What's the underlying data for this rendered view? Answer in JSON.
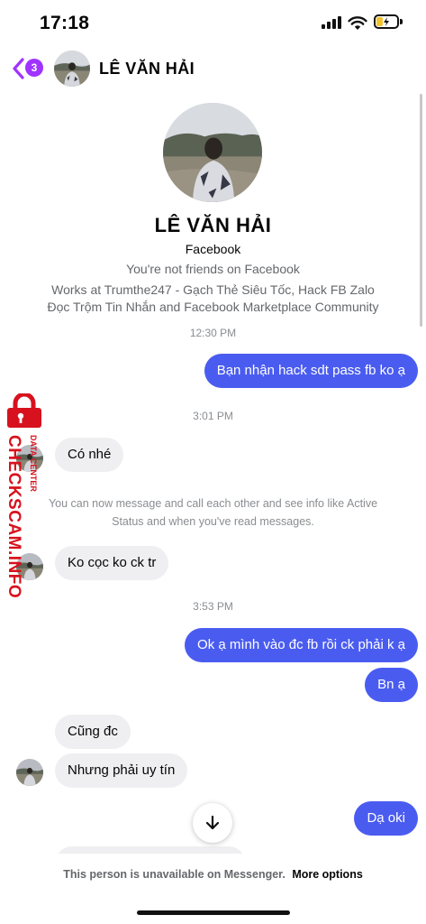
{
  "status_bar": {
    "time": "17:18"
  },
  "header": {
    "unread_count": "3",
    "contact_name": "LÊ VĂN HẢI"
  },
  "profile": {
    "name": "LÊ VĂN HẢI",
    "source": "Facebook",
    "friend_status": "You're not friends on Facebook",
    "works_line1": "Works at Trumthe247 - Gạch Thẻ Siêu Tốc, Hack FB Zalo",
    "works_line2": "Đọc Trộm Tin Nhắn and Facebook Marketplace Community"
  },
  "conversation": {
    "time_1": "12:30 PM",
    "msg_out_1": "Bạn nhận hack sdt pass fb ko ạ",
    "time_2": "3:01 PM",
    "msg_in_1": "Có nhé",
    "system_line1": "You can now message and call each other and see info like Active",
    "system_line2": "Status and when you've read messages.",
    "msg_in_2": "Ko cọc ko ck tr",
    "time_3": "3:53 PM",
    "msg_out_2": "Ok ạ mình vào đc fb rồi ck phải k ạ",
    "msg_out_3": "Bn ạ",
    "msg_in_3": "Cũng đc",
    "msg_in_4": "Nhưng phải uy tín",
    "msg_out_4": "Dạ oki"
  },
  "watermark": {
    "brand": "CHECKSCAM.INFO",
    "tagline": "DATA CENTER"
  },
  "footer": {
    "unavailable_text": "This person is unavailable on Messenger.",
    "more_options_label": "More options"
  },
  "colors": {
    "outgoing_bubble": "#4a5cf0",
    "incoming_bubble": "#efeff1",
    "badge": "#a033ff",
    "watermark": "#d7121e"
  }
}
